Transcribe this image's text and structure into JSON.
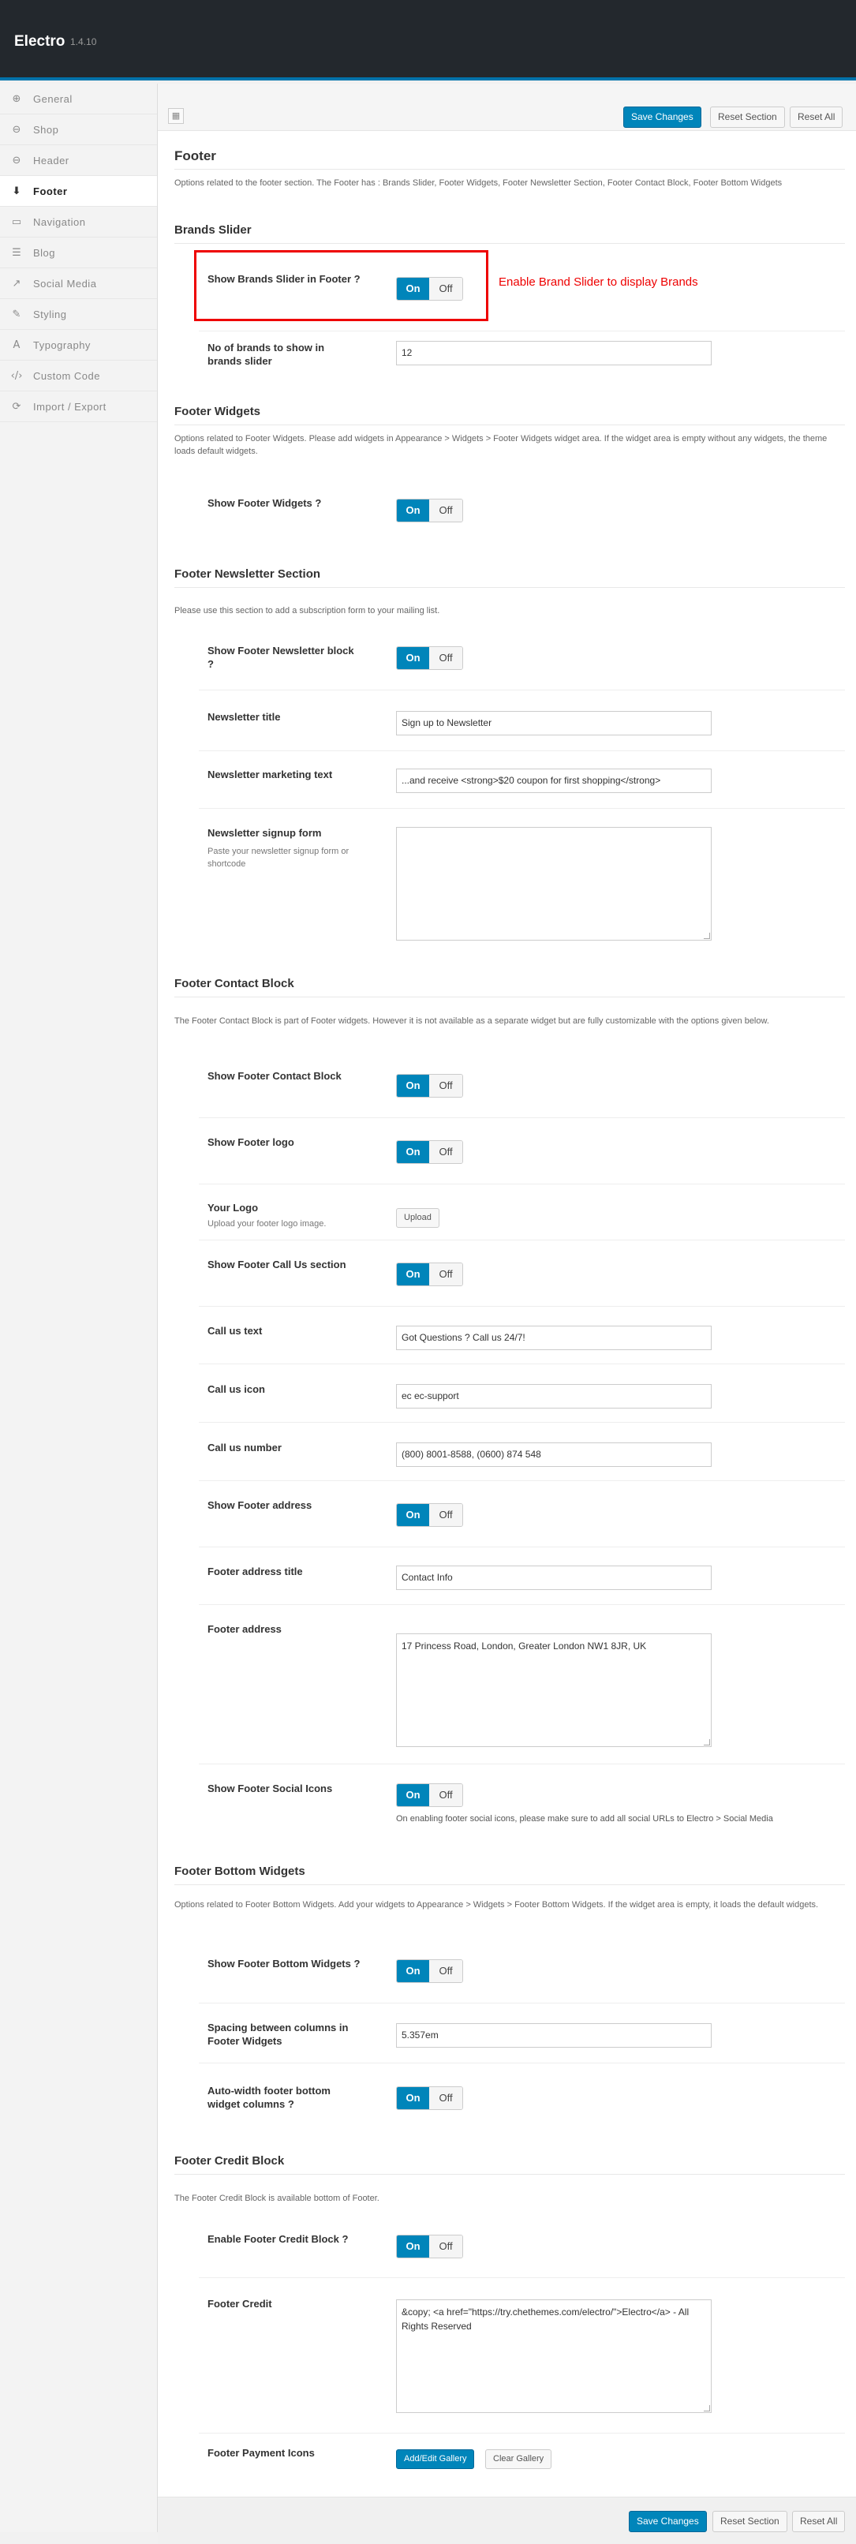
{
  "app": {
    "title": "Electro",
    "version": "1.4.10"
  },
  "sidebar": {
    "items": [
      {
        "icon": "⊕",
        "icon_name": "general-icon",
        "label": "General"
      },
      {
        "icon": "⊖",
        "icon_name": "shop-icon",
        "label": "Shop"
      },
      {
        "icon": "⊖",
        "icon_name": "header-icon",
        "label": "Header"
      },
      {
        "icon": "⬇",
        "icon_name": "footer-icon",
        "label": "Footer"
      },
      {
        "icon": "▭",
        "icon_name": "navigation-icon",
        "label": "Navigation"
      },
      {
        "icon": "☰",
        "icon_name": "blog-icon",
        "label": "Blog"
      },
      {
        "icon": "↗",
        "icon_name": "social-media-icon",
        "label": "Social Media"
      },
      {
        "icon": "✎",
        "icon_name": "styling-icon",
        "label": "Styling"
      },
      {
        "icon": "A",
        "icon_name": "typography-icon",
        "label": "Typography"
      },
      {
        "icon": "‹/›",
        "icon_name": "custom-code-icon",
        "label": "Custom Code"
      },
      {
        "icon": "⟳",
        "icon_name": "import-export-icon",
        "label": "Import / Export"
      }
    ],
    "active": "Footer"
  },
  "toolbar": {
    "save": "Save Changes",
    "reset_section": "Reset Section",
    "reset_all": "Reset All"
  },
  "footer": {
    "title": "Footer",
    "desc": "Options related to the footer section. The Footer has : Brands Slider, Footer Widgets, Footer Newsletter Section, Footer Contact Block, Footer Bottom Widgets"
  },
  "brands": {
    "title": "Brands Slider",
    "show_label": "Show Brands Slider in Footer ?",
    "count_label": "No of brands to show in brands slider",
    "count_value": "12",
    "annotation": "Enable Brand Slider to display Brands"
  },
  "widgets": {
    "title": "Footer Widgets",
    "desc": "Options related to Footer Widgets. Please add widgets in Appearance > Widgets > Footer Widgets widget area. If the widget area is empty without any widgets, the theme loads default widgets.",
    "show_label": "Show Footer Widgets ?"
  },
  "newsletter": {
    "title": "Footer Newsletter Section",
    "desc": "Please use this section to add a subscription form to your mailing list.",
    "show_label": "Show Footer Newsletter block ?",
    "title_label": "Newsletter title",
    "title_value": "Sign up to Newsletter",
    "marketing_label": "Newsletter marketing text",
    "marketing_value": "...and receive <strong>$20 coupon for first shopping</strong>",
    "form_label": "Newsletter signup form",
    "form_sub": "Paste your newsletter signup form or shortcode"
  },
  "contact": {
    "title": "Footer Contact Block",
    "desc": "The Footer Contact Block is part of Footer widgets. However it is not available as a separate widget but are fully customizable with the options given below.",
    "show_label": "Show Footer Contact Block",
    "logo_label": "Show Footer logo",
    "your_logo_label": "Your Logo",
    "your_logo_sub": "Upload your footer logo image.",
    "upload": "Upload",
    "callus_label": "Show Footer Call Us section",
    "calltext_label": "Call us text",
    "calltext_value": "Got Questions ? Call us 24/7!",
    "callicon_label": "Call us icon",
    "callicon_value": "ec ec-support",
    "callnum_label": "Call us number",
    "callnum_value": "(800) 8001-8588, (0600) 874 548",
    "showaddr_label": "Show Footer address",
    "addrtitle_label": "Footer address title",
    "addrtitle_value": "Contact Info",
    "addr_label": "Footer address",
    "addr_value": "17 Princess Road, London, Greater London NW1 8JR, UK",
    "social_label": "Show Footer Social Icons",
    "social_note": "On enabling footer social icons, please make sure to add all social URLs to Electro > Social Media"
  },
  "bottom": {
    "title": "Footer Bottom Widgets",
    "desc": "Options related to Footer Bottom Widgets. Add your widgets to Appearance > Widgets > Footer Bottom Widgets. If the widget area is empty, it loads the default widgets.",
    "show_label": "Show Footer Bottom Widgets ?",
    "spacing_label": "Spacing between columns in Footer Widgets",
    "spacing_value": "5.357em",
    "autowidth_label": "Auto-width footer bottom widget columns ?"
  },
  "credit": {
    "title": "Footer Credit Block",
    "desc": "The Footer Credit Block is available bottom of Footer.",
    "enable_label": "Enable Footer Credit Block ?",
    "credit_label": "Footer Credit",
    "credit_value": "&copy; <a href=\"https://try.chethemes.com/electro/\">Electro</a> - All Rights Reserved",
    "payment_label": "Footer Payment Icons",
    "add_gallery": "Add/Edit Gallery",
    "clear_gallery": "Clear Gallery"
  },
  "toggle": {
    "on": "On",
    "off": "Off"
  },
  "colors": {
    "accent": "#0085ba",
    "header": "#23282d",
    "annotation": "#ee0000"
  }
}
